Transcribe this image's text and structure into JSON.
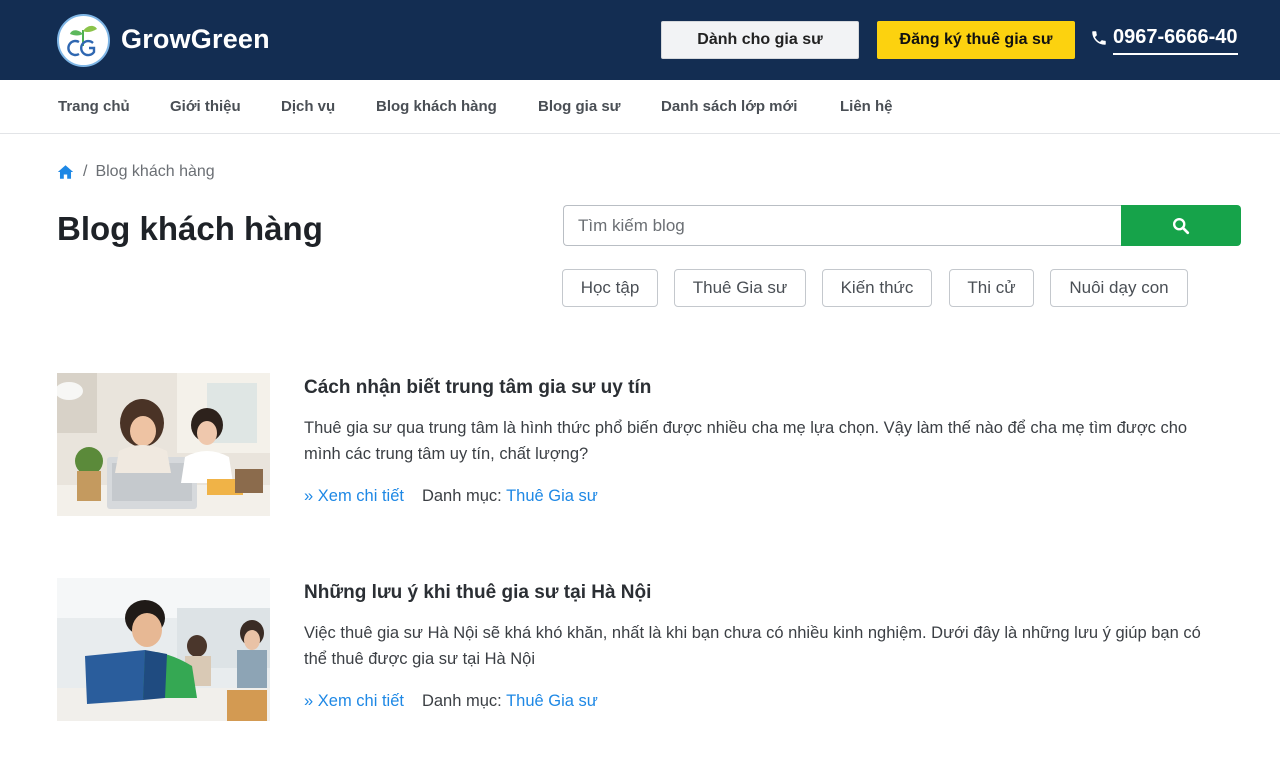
{
  "header": {
    "brand": "GrowGreen",
    "btn_tutor": "Dành cho gia sư",
    "btn_register": "Đăng ký thuê gia sư",
    "phone": "0967-6666-40"
  },
  "nav": {
    "items": [
      "Trang chủ",
      "Giới thiệu",
      "Dịch vụ",
      "Blog khách hàng",
      "Blog gia sư",
      "Danh sách lớp mới",
      "Liên hệ"
    ]
  },
  "breadcrumb": {
    "separator": "/",
    "current": "Blog khách hàng"
  },
  "page_title": "Blog khách hàng",
  "search": {
    "placeholder": "Tìm kiếm blog",
    "value": ""
  },
  "tags": [
    "Học tập",
    "Thuê Gia sư",
    "Kiến thức",
    "Thi cử",
    "Nuôi dạy con"
  ],
  "posts": [
    {
      "title": "Cách nhận biết trung tâm gia sư uy tín",
      "excerpt": "Thuê gia sư qua trung tâm là hình thức phổ biến được nhiều cha mẹ lựa chọn. Vậy làm thế nào để cha mẹ tìm được cho mình các trung tâm uy tín, chất lượng?",
      "read_more": "» Xem chi tiết",
      "category_label": "Danh mục:",
      "category": "Thuê Gia sư"
    },
    {
      "title": "Những lưu ý khi thuê gia sư tại Hà Nội",
      "excerpt": "Việc thuê gia sư Hà Nội sẽ khá khó khăn, nhất là khi bạn chưa có nhiều kinh nghiệm. Dưới đây là những lưu ý giúp bạn có thể thuê được gia sư tại Hà Nội",
      "read_more": "» Xem chi tiết",
      "category_label": "Danh mục:",
      "category": "Thuê Gia sư"
    }
  ],
  "colors": {
    "header_bg": "#132d52",
    "accent_yellow": "#fcd20f",
    "search_green": "#16a34a",
    "link_blue": "#1e88e5"
  }
}
